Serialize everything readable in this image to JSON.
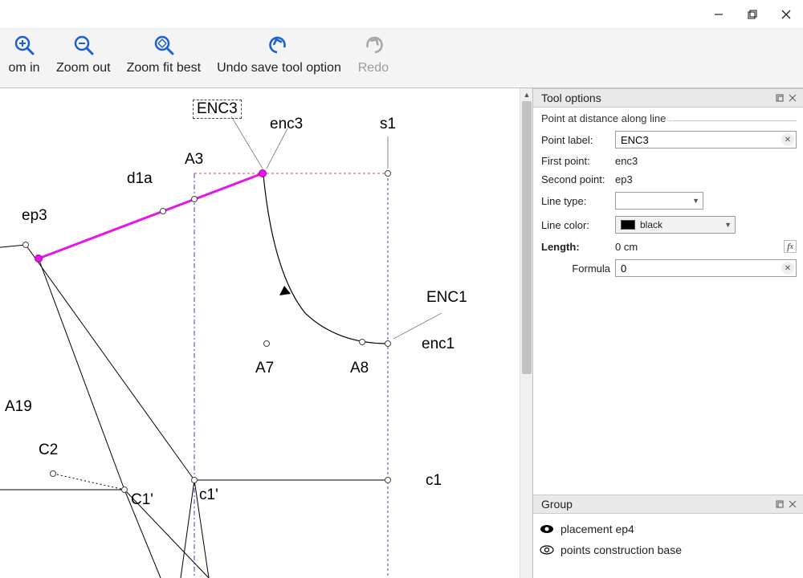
{
  "window": {},
  "toolbar": {
    "zoom_in": "om in",
    "zoom_out": "Zoom out",
    "zoom_fit": "Zoom fit best",
    "undo": "Undo save tool option",
    "redo": "Redo"
  },
  "canvas": {
    "labels": {
      "ENC3": "ENC3",
      "enc3": "enc3",
      "s1": "s1",
      "A3": "A3",
      "d1a": "d1a",
      "ep3": "ep3",
      "A19": "A19",
      "C2": "C2",
      "C1p": "C1'",
      "c1p": "c1'",
      "A7": "A7",
      "A8": "A8",
      "ENC1": "ENC1",
      "enc1": "enc1",
      "c1": "c1"
    }
  },
  "panels": {
    "tool_options": {
      "title": "Tool options",
      "legend": "Point at distance along line",
      "rows": {
        "point_label_lbl": "Point label:",
        "point_label_val": "ENC3",
        "first_point_lbl": "First point:",
        "first_point_val": "enc3",
        "second_point_lbl": "Second point:",
        "second_point_val": "ep3",
        "line_type_lbl": "Line type:",
        "line_color_lbl": "Line color:",
        "line_color_val": "black",
        "length_lbl": "Length:",
        "length_val": "0 cm",
        "formula_lbl": "Formula",
        "formula_val": "0"
      }
    },
    "group": {
      "title": "Group",
      "items": [
        {
          "label": "placement ep4",
          "visible": true
        },
        {
          "label": "points construction base",
          "visible_outline": true
        }
      ]
    }
  }
}
